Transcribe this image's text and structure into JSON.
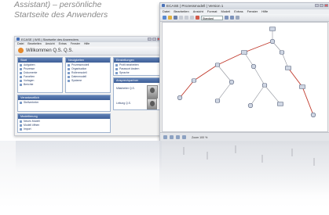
{
  "caption": {
    "line1": "Assistant) – persönliche",
    "line2": "Startseite des Anwenders"
  },
  "left_window": {
    "title": "ECASE | WIS | Startseite des Anwenders",
    "menu": [
      "Datei",
      "Bearbeiten",
      "Ansicht",
      "Extras",
      "Fenster",
      "Hilfe"
    ],
    "welcome": "Willkommen Q.S. Q.S.",
    "panel_start": {
      "header": "Start",
      "items": [
        "Aufgaben",
        "Prozesse",
        "Dokumente",
        "Favoriten",
        "Vorlagen",
        "Berichte"
      ]
    },
    "panel_news": {
      "header": "Neuigkeiten",
      "items": [
        "Prozessmodell",
        "Organisation",
        "Rollenmodell",
        "Datenmodell",
        "Systeme"
      ]
    },
    "panel_middle": {
      "header": "Einstellungen",
      "items": [
        "Profil bearbeiten",
        "Passwort ändern",
        "Sprache"
      ]
    },
    "panel_info": {
      "header": "Ansprechpartner",
      "items": [
        "Verantwortlich",
        "Stellvertreter"
      ]
    },
    "panel_bottom": {
      "header": "Modellierung",
      "items": [
        "Neues Modell",
        "Modell öffnen",
        "Import"
      ]
    },
    "person1": "Mitarbeiter Q.S.",
    "person2": "Leitung Q.S."
  },
  "right_window": {
    "title": "ECASE | Prozessmodell | Version 1",
    "menu": [
      "Datei",
      "Bearbeiten",
      "Ansicht",
      "Format",
      "Modell",
      "Extras",
      "Fenster",
      "Hilfe"
    ],
    "combo_value": "Standard",
    "status_text": "Zoom 100 %"
  },
  "colors": {
    "caption": "#8a8a8a",
    "panel_header": "#4a6aa3",
    "edge_red": "#c0392b",
    "edge_gray": "#8f939c",
    "node_fill": "#cfd6e3",
    "node_stroke": "#55607a"
  },
  "diagram": {
    "nodes": [
      {
        "id": "n1",
        "kind": "process"
      },
      {
        "id": "n2",
        "kind": "event"
      },
      {
        "id": "n3",
        "kind": "process"
      },
      {
        "id": "n4",
        "kind": "function"
      },
      {
        "id": "n5",
        "kind": "function"
      },
      {
        "id": "n6",
        "kind": "event"
      },
      {
        "id": "n7",
        "kind": "process"
      },
      {
        "id": "n8",
        "kind": "function"
      },
      {
        "id": "n9",
        "kind": "event"
      },
      {
        "id": "n10",
        "kind": "function"
      },
      {
        "id": "n11",
        "kind": "process"
      },
      {
        "id": "n12",
        "kind": "event"
      },
      {
        "id": "n13",
        "kind": "function"
      },
      {
        "id": "n14",
        "kind": "event"
      },
      {
        "id": "n15",
        "kind": "process"
      },
      {
        "id": "n16",
        "kind": "event"
      }
    ]
  }
}
